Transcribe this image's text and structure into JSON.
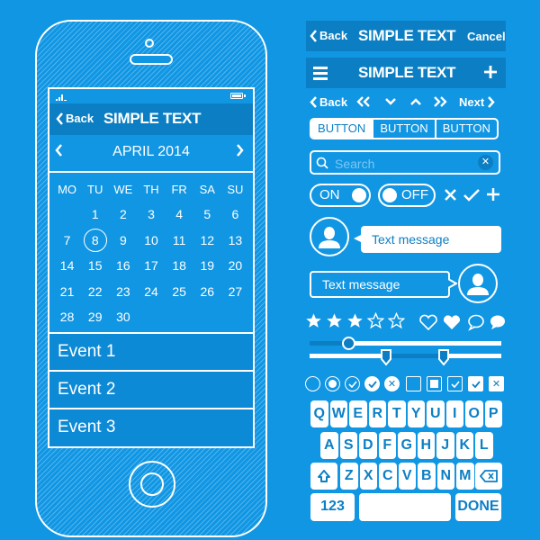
{
  "colors": {
    "background": "#1196e3",
    "dark_accent": "#0c7fc4",
    "foreground": "#ffffff"
  },
  "phone": {
    "navbar": {
      "back_label": "Back",
      "title": "SIMPLE TEXT"
    },
    "calendar": {
      "month_label": "APRIL 2014",
      "weekdays": [
        "MO",
        "TU",
        "WE",
        "TH",
        "FR",
        "SA",
        "SU"
      ],
      "days": [
        "",
        "1",
        "2",
        "3",
        "4",
        "5",
        "6",
        "7",
        "8",
        "9",
        "10",
        "11",
        "12",
        "13",
        "14",
        "15",
        "16",
        "17",
        "18",
        "19",
        "20",
        "21",
        "22",
        "23",
        "24",
        "25",
        "26",
        "27",
        "28",
        "29",
        "30",
        "",
        "",
        "",
        ""
      ],
      "selected_day": "8"
    },
    "events": [
      "Event 1",
      "Event 2",
      "Event 3"
    ]
  },
  "kit": {
    "navbar1": {
      "back_label": "Back",
      "title": "SIMPLE TEXT",
      "cancel_label": "Cancel"
    },
    "navbar2": {
      "title": "SIMPLE TEXT"
    },
    "pager": {
      "back_label": "Back",
      "next_label": "Next"
    },
    "segmented": [
      "BUTTON",
      "BUTTON",
      "BUTTON"
    ],
    "search": {
      "placeholder": "Search"
    },
    "toggles": {
      "on_label": "ON",
      "off_label": "OFF"
    },
    "messages": {
      "incoming": "Text message",
      "outgoing": "Text message"
    },
    "rating": {
      "filled_stars": 3,
      "total_stars": 5
    },
    "slider": {
      "value": 0.2
    },
    "range_slider": {
      "low": 0.4,
      "high": 0.7
    },
    "keyboard": {
      "row1": [
        "Q",
        "W",
        "E",
        "R",
        "T",
        "Y",
        "U",
        "I",
        "O",
        "P"
      ],
      "row2": [
        "A",
        "S",
        "D",
        "F",
        "G",
        "H",
        "J",
        "K",
        "L"
      ],
      "row3": [
        "Z",
        "X",
        "C",
        "V",
        "B",
        "N",
        "M"
      ],
      "numbers_label": "123",
      "done_label": "DONE"
    }
  }
}
